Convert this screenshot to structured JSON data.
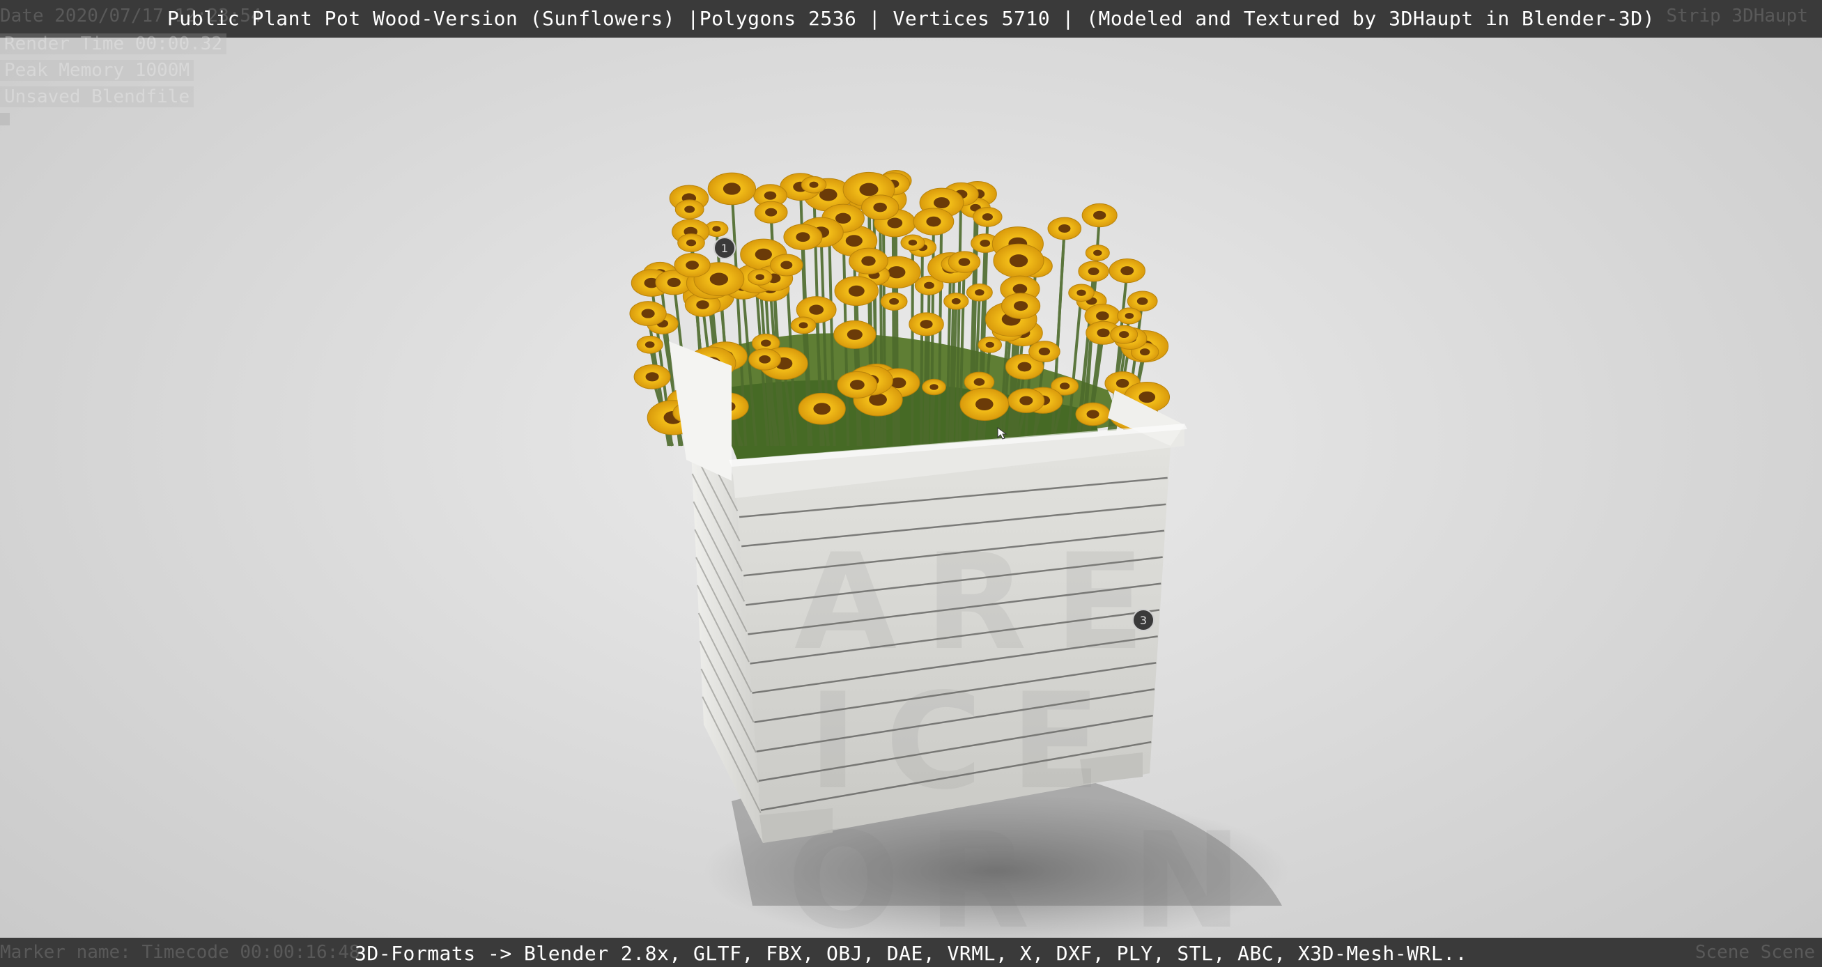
{
  "header": {
    "title": "Public Plant Pot Wood-Version (Sunflowers) |Polygons 2536 | Vertices 5710 | (Modeled and Textured by 3DHaupt in Blender-3D)",
    "left_faded": "Date 2020/07/17 12:23:54",
    "right_faded": "Strip 3DHaupt"
  },
  "info_overlay": {
    "lines": [
      "Render Time 00:00.32",
      "Peak Memory 1000M",
      "Unsaved Blendfile"
    ]
  },
  "footer": {
    "formats": "3D-Formats -> Blender 2.8x, GLTF, FBX, OBJ, DAE, VRML, X, DXF, PLY, STL, ABC, X3D-Mesh-WRL..",
    "left_faded": "Marker name:   Timecode 00:00:16:48",
    "right_faded": "Scene Scene"
  },
  "viewport": {
    "hotspots": [
      "1",
      "3"
    ],
    "colors": {
      "petal": "#f2b816",
      "center": "#6b3b08",
      "wood": "#d9d9d5",
      "stem": "#4d6b2c"
    }
  }
}
